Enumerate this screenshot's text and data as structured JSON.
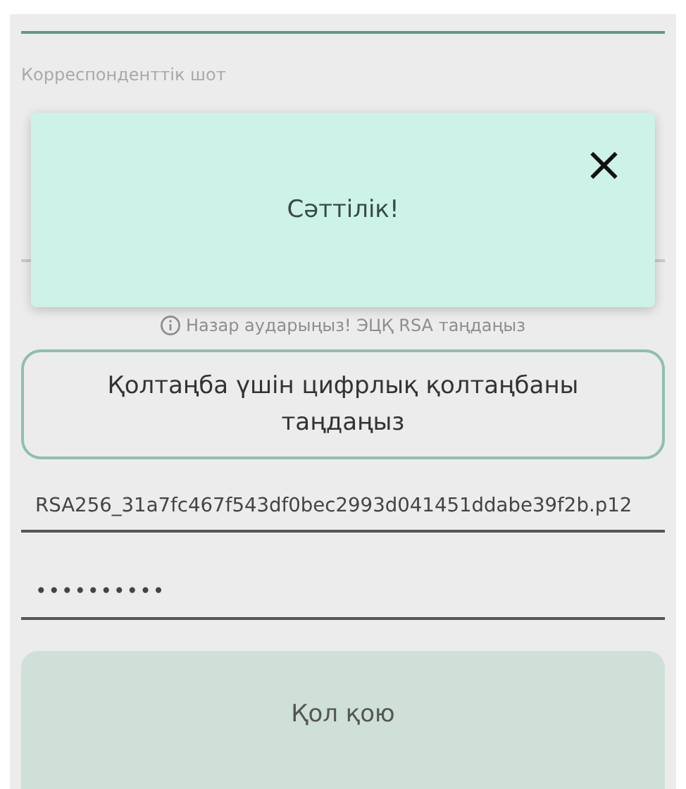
{
  "form": {
    "account_label": "Корреспонденттік шот",
    "notice": "Назар аударыңыз! ЭЦҚ RSA таңдаңыз",
    "select_signature_button": "Қолтаңба үшін цифрлық қолтаңбаны таңдаңыз",
    "certificate_file": "RSA256_31a7fc467f543df0bec2993d041451ddabe39f2b.p12",
    "password": "••••••••••",
    "sign_button": "Қол қою"
  },
  "dialog": {
    "message": "Сәттілік!",
    "close": "×"
  }
}
